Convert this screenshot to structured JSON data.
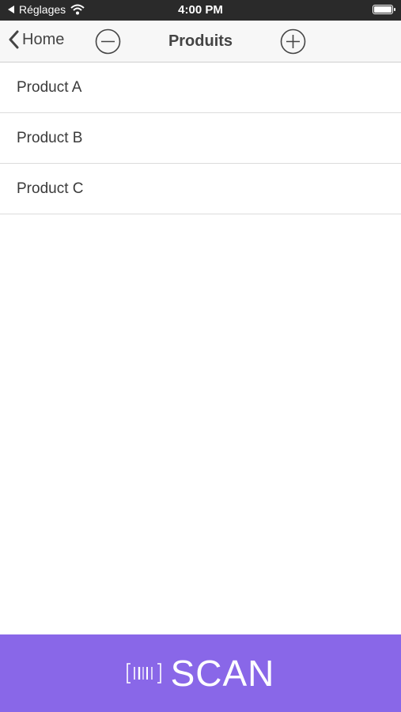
{
  "status_bar": {
    "back_app": "Réglages",
    "time": "4:00 PM",
    "battery_level": 1.0
  },
  "nav": {
    "back_label": "Home",
    "title": "Produits",
    "remove_icon": "minus-circle-icon",
    "add_icon": "plus-circle-icon"
  },
  "products": [
    {
      "name": "Product A"
    },
    {
      "name": "Product B"
    },
    {
      "name": "Product C"
    }
  ],
  "scan": {
    "label": "SCAN",
    "icon": "barcode-icon"
  },
  "colors": {
    "accent": "#8967e8",
    "status_bar": "#2a2a2a",
    "nav_background": "#f7f7f7"
  }
}
